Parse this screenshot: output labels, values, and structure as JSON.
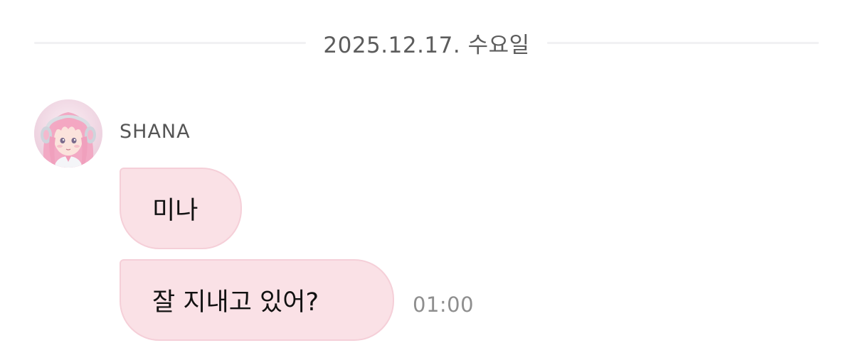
{
  "date_separator": {
    "text": "2025.12.17. 수요일"
  },
  "sender": {
    "name": "SHANA",
    "avatar_icon": "anime-girl-avatar-icon"
  },
  "messages": [
    {
      "text": "미나"
    },
    {
      "text": "잘 지내고 있어?",
      "time": "01:00"
    }
  ],
  "colors": {
    "bubble_fill": "#fae1e6",
    "bubble_border": "#f5cfd8",
    "timestamp": "#8e8e8e",
    "separator_line": "#f1f1f3"
  }
}
